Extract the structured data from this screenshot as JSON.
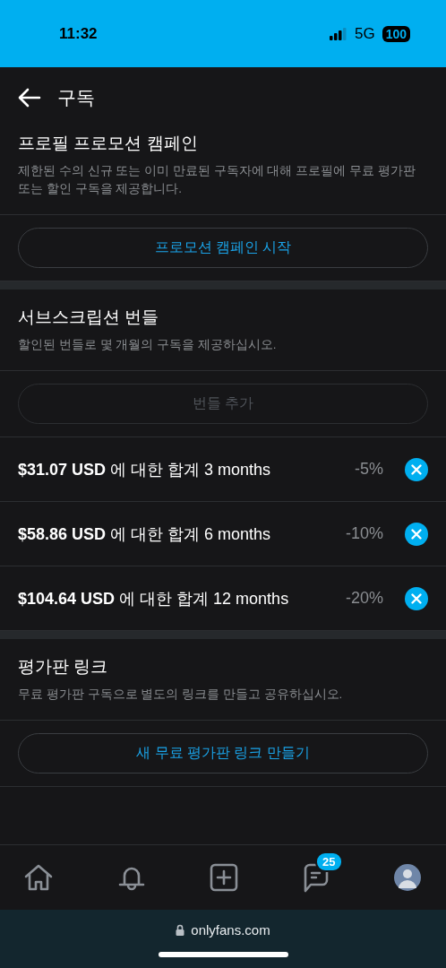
{
  "status_bar": {
    "time": "11:32",
    "network": "5G",
    "battery": "100"
  },
  "header": {
    "title": "구독"
  },
  "sections": [
    {
      "title": "프로필 프로모션 캠페인",
      "description": "제한된 수의 신규 또는 이미 만료된 구독자에 대해 프로필에 무료 평가판 또는 할인 구독을 제공합니다.",
      "button": {
        "label": "프로모션 캠페인 시작",
        "disabled": false
      }
    },
    {
      "title": "서브스크립션 번들",
      "description": "할인된 번들로 몇 개월의 구독을 제공하십시오.",
      "button": {
        "label": "번들 추가",
        "disabled": true
      },
      "bundles": [
        {
          "text": "**$31.07 USD** 에 대한 합계 3 months",
          "discount": "-5%"
        },
        {
          "text": "**$58.86 USD** 에 대한 합계 6 months",
          "discount": "-10%"
        },
        {
          "text": "**$104.64 USD** 에 대한 합계 12 months",
          "discount": "-20%"
        }
      ]
    },
    {
      "title": "평가판 링크",
      "description": "무료 평가판 구독으로 별도의 링크를 만들고 공유하십시오.",
      "button": {
        "label": "새 무료 평가판 링크 만들기",
        "disabled": false
      }
    }
  ],
  "bottom_nav": {
    "items": [
      {
        "kind": "home"
      },
      {
        "kind": "bell"
      },
      {
        "kind": "add"
      },
      {
        "kind": "messages",
        "badge": "25"
      },
      {
        "kind": "avatar"
      }
    ]
  },
  "browser_bar": {
    "url": "onlyfans.com"
  }
}
